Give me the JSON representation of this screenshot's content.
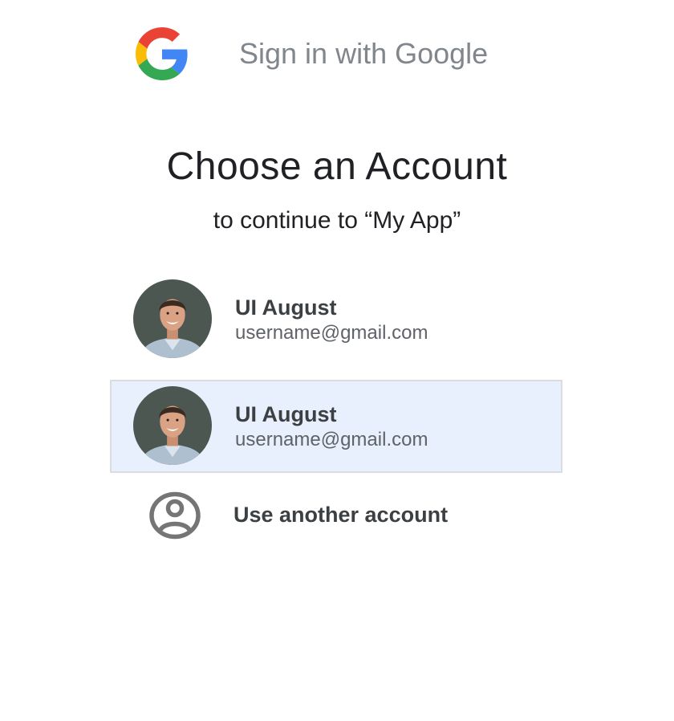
{
  "header": {
    "logo_icon": "google-g-icon",
    "title": "Sign in with Google"
  },
  "main": {
    "title": "Choose an Account",
    "subtitle": "to continue to “My App”"
  },
  "accounts": [
    {
      "name": "UI August",
      "email": "username@gmail.com",
      "avatar_icon": "profile-photo",
      "selected": false
    },
    {
      "name": "UI August",
      "email": "username@gmail.com",
      "avatar_icon": "profile-photo",
      "selected": true
    }
  ],
  "another_account": {
    "icon": "account-circle-icon",
    "label": "Use another account"
  },
  "colors": {
    "selected_background": "#e8f0fd",
    "selected_border": "#dadce0",
    "header_text": "#80868b",
    "google_blue": "#4285f4",
    "google_red": "#ea4335",
    "google_yellow": "#fbbc05",
    "google_green": "#34a853"
  }
}
